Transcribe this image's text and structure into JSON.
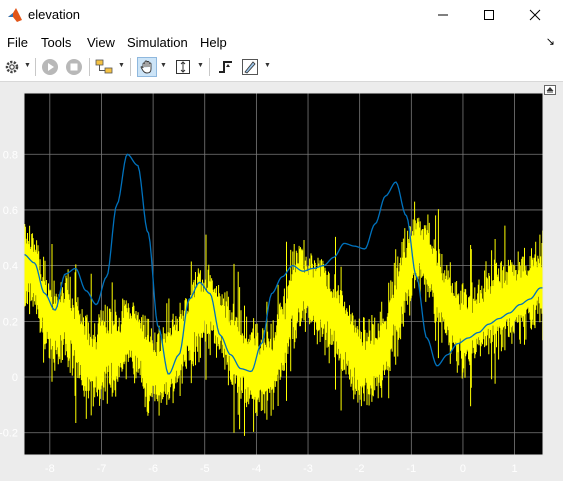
{
  "window": {
    "title": "elevation"
  },
  "menu": {
    "items": [
      "File",
      "Tools",
      "View",
      "Simulation",
      "Help"
    ],
    "collapse_glyph": "↘"
  },
  "toolbar": {
    "buttons": [
      "settings-icon",
      "run-icon",
      "stop-icon",
      "signal-selector-icon",
      "pan-icon",
      "zoom-icon",
      "triggers-icon",
      "style-icon"
    ]
  },
  "colors": {
    "plot_background": "#000000",
    "axes_frame": "#e6e6e6",
    "grid": "#7a7a7a",
    "tick_labels": "#ffffff",
    "series_1": "#ffff00",
    "series_2": "#0072bd"
  },
  "chart_data": {
    "type": "line",
    "grid": true,
    "xlim": [
      -8.5,
      1.55
    ],
    "ylim": [
      -0.28,
      1.02
    ],
    "xticks": [
      -8,
      -7,
      -6,
      -5,
      -4,
      -3,
      -2,
      -1,
      0,
      1
    ],
    "yticks": [
      -0.2,
      0,
      0.2,
      0.4,
      0.6,
      0.8
    ],
    "xtick_labels": [
      "-8",
      "-7",
      "-6",
      "-5",
      "-4",
      "-3",
      "-2",
      "-1",
      "0",
      "1"
    ],
    "ytick_labels": [
      "-0.2",
      "0",
      "0.2",
      "0.4",
      "0.6",
      "0.8"
    ],
    "series": [
      {
        "color": "#ffff00",
        "x": [
          -8.5,
          -8.3,
          -8.1,
          -7.9,
          -7.7,
          -7.5,
          -7.3,
          -7.1,
          -6.9,
          -6.7,
          -6.5,
          -6.3,
          -6.1,
          -5.9,
          -5.7,
          -5.5,
          -5.3,
          -5.1,
          -4.9,
          -4.7,
          -4.5,
          -4.3,
          -4.1,
          -3.9,
          -3.7,
          -3.5,
          -3.3,
          -3.1,
          -2.9,
          -2.7,
          -2.5,
          -2.3,
          -2.1,
          -1.9,
          -1.7,
          -1.5,
          -1.3,
          -1.1,
          -0.9,
          -0.7,
          -0.5,
          -0.3,
          -0.1,
          0.1,
          0.3,
          0.5,
          0.7,
          0.9,
          1.1,
          1.3,
          1.5
        ],
        "y": [
          0.4,
          0.38,
          0.24,
          0.18,
          0.22,
          0.15,
          0.06,
          0.05,
          0.1,
          0.09,
          0.16,
          0.13,
          0.04,
          0.02,
          0.05,
          0.1,
          0.18,
          0.24,
          0.26,
          0.2,
          0.12,
          0.06,
          0.03,
          0.02,
          0.04,
          0.13,
          0.28,
          0.33,
          0.3,
          0.27,
          0.22,
          0.16,
          0.08,
          0.04,
          0.06,
          0.12,
          0.25,
          0.37,
          0.46,
          0.43,
          0.33,
          0.25,
          0.19,
          0.16,
          0.21,
          0.24,
          0.26,
          0.28,
          0.3,
          0.31,
          0.34
        ]
      },
      {
        "color": "#0072bd",
        "x": [
          -8.5,
          -8.3,
          -8.1,
          -7.9,
          -7.7,
          -7.5,
          -7.3,
          -7.1,
          -6.9,
          -6.7,
          -6.5,
          -6.3,
          -6.1,
          -5.9,
          -5.7,
          -5.5,
          -5.3,
          -5.1,
          -4.9,
          -4.7,
          -4.5,
          -4.3,
          -4.1,
          -3.9,
          -3.7,
          -3.5,
          -3.3,
          -3.1,
          -2.9,
          -2.7,
          -2.5,
          -2.3,
          -2.1,
          -1.9,
          -1.7,
          -1.5,
          -1.3,
          -1.1,
          -0.9,
          -0.7,
          -0.5,
          -0.3,
          -0.1,
          0.1,
          0.3,
          0.5,
          0.7,
          0.9,
          1.1,
          1.3,
          1.5
        ],
        "y": [
          0.44,
          0.41,
          0.3,
          0.24,
          0.37,
          0.39,
          0.31,
          0.26,
          0.36,
          0.62,
          0.8,
          0.76,
          0.52,
          0.18,
          0.01,
          0.08,
          0.28,
          0.34,
          0.3,
          0.15,
          0.08,
          0.03,
          0.02,
          0.12,
          0.3,
          0.36,
          0.4,
          0.38,
          0.39,
          0.4,
          0.43,
          0.48,
          0.47,
          0.46,
          0.55,
          0.65,
          0.7,
          0.58,
          0.36,
          0.14,
          0.04,
          0.08,
          0.12,
          0.14,
          0.16,
          0.19,
          0.21,
          0.23,
          0.26,
          0.28,
          0.32
        ]
      }
    ]
  }
}
